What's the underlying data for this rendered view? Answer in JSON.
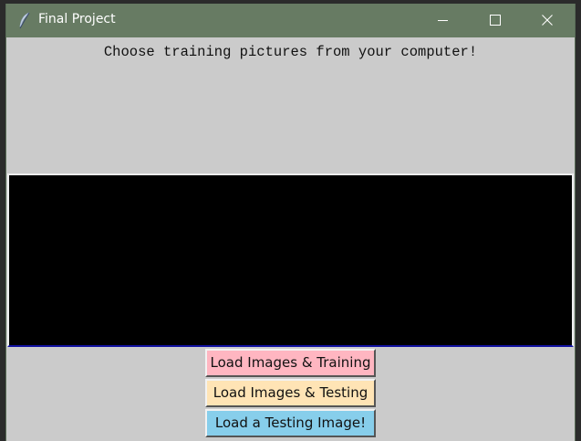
{
  "window": {
    "title": "Final Project",
    "icon": "feather-icon",
    "controls": [
      "minimize-icon",
      "maximize-icon",
      "close-icon"
    ],
    "titlebar_color": "#677b63",
    "background_color": "#cbcbcb"
  },
  "main": {
    "prompt": "Choose training pictures from your computer!",
    "canvas_color": "#000000"
  },
  "buttons": {
    "load_training": {
      "label": "Load Images & Training",
      "color": "#ffb6c1"
    },
    "load_testing": {
      "label": "Load Images & Testing",
      "color": "#ffe4b5"
    },
    "load_test_image": {
      "label": "Load a Testing Image!",
      "color": "#87ceeb"
    }
  }
}
